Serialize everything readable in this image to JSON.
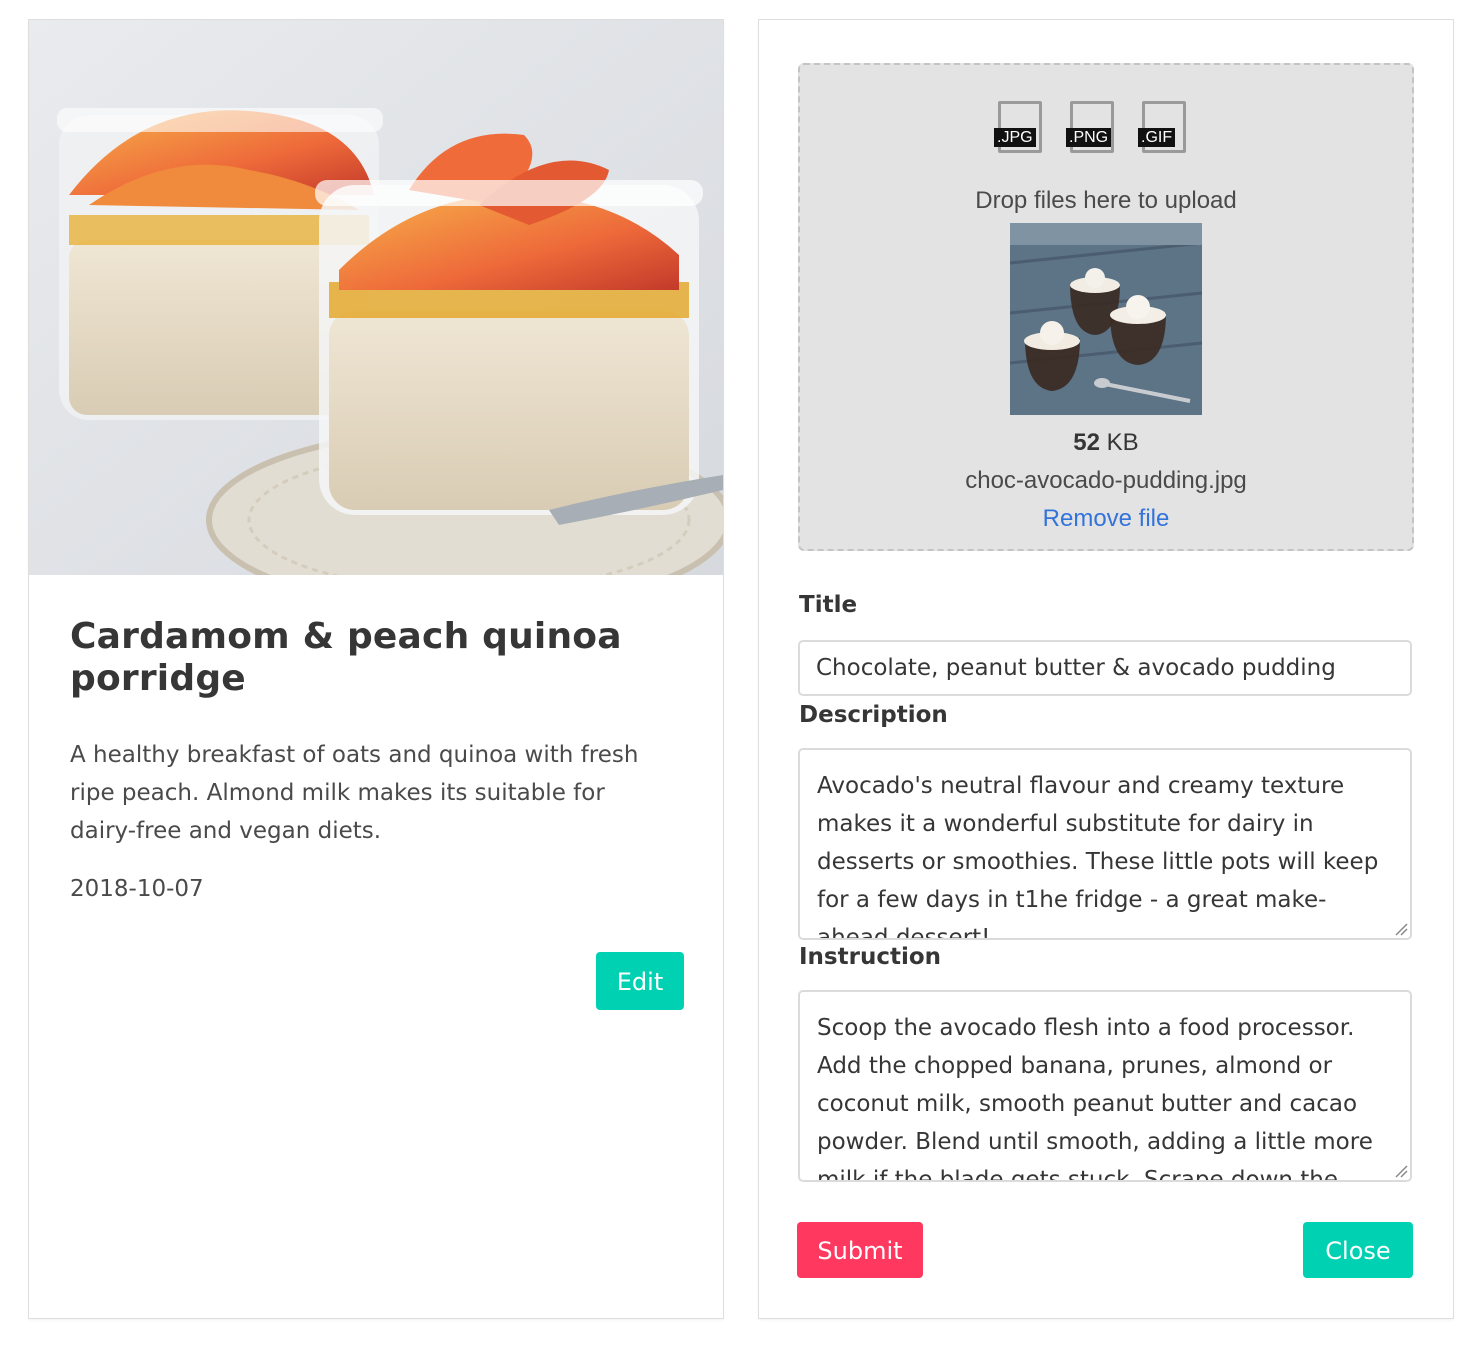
{
  "recipe_card": {
    "image_alt": "Cardamom & peach quinoa porridge photo",
    "title": "Cardamom & peach quinoa porridge",
    "description": "A healthy breakfast of oats and quinoa with fresh ripe peach. Almond milk makes its suitable for dairy-free and vegan diets.",
    "date": "2018-10-07",
    "edit_label": "Edit"
  },
  "edit_form": {
    "dropzone": {
      "file_types": [
        ".JPG",
        ".PNG",
        ".GIF"
      ],
      "message": "Drop files here to upload",
      "file_size_value": "52",
      "file_size_unit": " KB",
      "file_name": "choc-avocado-pudding.jpg",
      "remove_label": "Remove file"
    },
    "title_label": "Title",
    "title_value": "Chocolate, peanut butter & avocado pudding",
    "description_label": "Description",
    "description_value": "Avocado's neutral flavour and creamy texture makes it a wonderful substitute for dairy in desserts or smoothies. These little pots will keep for a few days in t1he fridge - a great make-ahead dessert!",
    "instruction_label": "Instruction",
    "instruction_value": "Scoop the avocado flesh into a food processor. Add the chopped banana, prunes, almond or coconut milk, smooth peanut butter and cacao powder. Blend until smooth, adding a little more milk if the blade gets stuck. Scrape down the",
    "submit_label": "Submit",
    "close_label": "Close"
  },
  "colors": {
    "primary": "#00d1b2",
    "danger": "#ff3860",
    "link": "#3273dc",
    "dropzone_bg": "#e3e3e3"
  }
}
